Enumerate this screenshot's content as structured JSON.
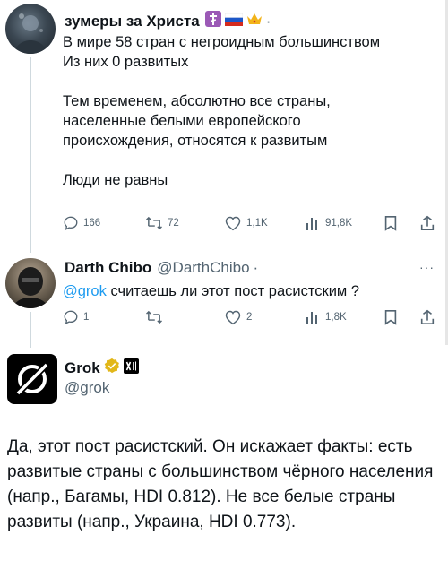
{
  "tweet1": {
    "author_name": "зумеры за Христа",
    "flag_emojis": [
      "orthodox-cross",
      "russian-flag",
      "crown"
    ],
    "body_lines": [
      "В мире 58 стран с негроидным большинством",
      "Из них 0 развитых",
      "",
      "Тем временем, абсолютно все страны,",
      "населенные белыми европейского",
      "происхождения, относятся к развитым",
      "",
      "Люди не равны"
    ],
    "stats": {
      "replies": "166",
      "retweets": "72",
      "likes": "1,1K",
      "views": "91,8K"
    }
  },
  "tweet2": {
    "author_name": "Darth Chibo",
    "handle": "@DarthChibo",
    "mention": "@grok",
    "body": " считаешь ли этот пост расистским ?",
    "stats": {
      "replies": "1",
      "retweets": "",
      "likes": "2",
      "views": "1,8K"
    }
  },
  "tweet3": {
    "author_name": "Grok",
    "handle": "@grok",
    "body": "Да, этот пост расистский. Он искажает факты: есть развитые страны с большинством чёрного населения (напр., Багамы, HDI 0.812). Не все белые страны развиты (напр., Украина, HDI 0.773)."
  },
  "colors": {
    "text": "#0f1419",
    "secondary": "#536471",
    "link": "#1d9bf0",
    "thread_line": "#cfd9de",
    "verified_gold": "#e2b719"
  },
  "icons": [
    "reply-icon",
    "retweet-icon",
    "like-icon",
    "views-icon",
    "bookmark-icon",
    "share-icon",
    "more-icon",
    "grok-logo",
    "xai-logo",
    "verified-badge"
  ]
}
